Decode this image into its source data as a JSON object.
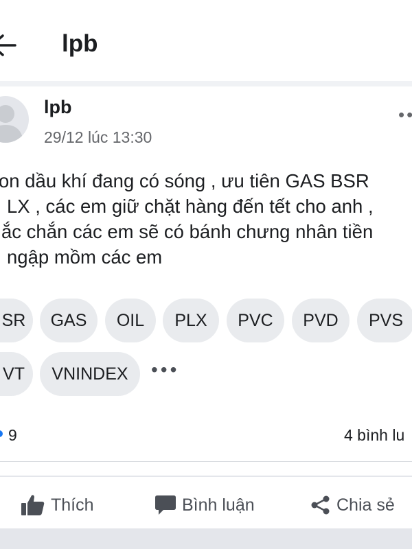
{
  "header": {
    "title": "lpb"
  },
  "post": {
    "author": "lpb",
    "timestamp": "29/12 lúc 13:30",
    "text_lines": [
      "on dầu khí đang có sóng , ưu tiên GAS BSR",
      "LX , các em giữ chặt hàng đến tết cho anh ,",
      "ắc chắn các em sẽ có bánh chưng nhân tiền",
      "ngập mồm các em"
    ],
    "tags_row1": [
      "SR",
      "GAS",
      "OIL",
      "PLX",
      "PVC",
      "PVD",
      "PVS"
    ],
    "tags_row2": [
      "VT",
      "VNINDEX"
    ],
    "reactions_count": "9",
    "comments_label": "4 bình lu"
  },
  "actions": {
    "like": "Thích",
    "comment": "Bình luận",
    "share": "Chia sẻ"
  },
  "icons": [
    "back-arrow-icon",
    "avatar-placeholder",
    "more-dots-icon",
    "thumbs-up-icon",
    "comment-bubble-icon",
    "share-icon"
  ],
  "colors": {
    "reaction_blue": "#1877f2",
    "tag_bg": "#e9ebee",
    "muted_text": "#65676b"
  }
}
